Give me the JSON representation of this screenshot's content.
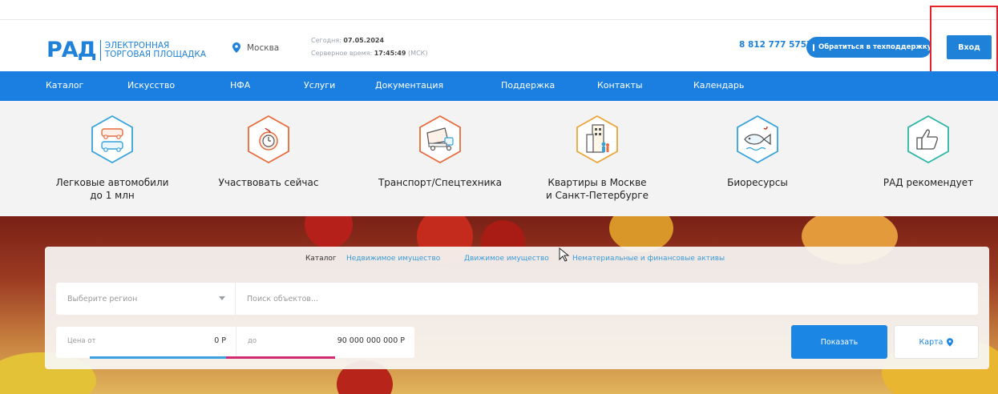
{
  "header": {
    "logo_mark": "РАД",
    "logo_line1": "ЭЛЕКТРОННАЯ",
    "logo_line2": "ТОРГОВАЯ ПЛОЩАДКА",
    "city": "Москва",
    "today_label": "Сегодня:",
    "today_value": "07.05.2024",
    "server_time_label": "Серверное время:",
    "server_time_value": "17:45:49",
    "server_time_zone": "(МСК)",
    "phone": "8 812 777 5757",
    "support_button": "Обратиться в техподдержку",
    "login_button": "Вход"
  },
  "nav": {
    "items": [
      "Каталог",
      "Искусство",
      "НФА",
      "Услуги",
      "Документация",
      "Поддержка",
      "Контакты",
      "Календарь"
    ]
  },
  "categories": [
    {
      "line1": "Легковые автомобили",
      "line2": "до 1 млн",
      "icon": "car-icon"
    },
    {
      "line1": "Участвовать сейчас",
      "line2": "",
      "icon": "timer-flame-icon"
    },
    {
      "line1": "Транспорт/Спецтехника",
      "line2": "",
      "icon": "dump-truck-icon"
    },
    {
      "line1": "Квартиры в Москве",
      "line2": "и Санкт-Петербурге",
      "icon": "apartment-building-icon"
    },
    {
      "line1": "Биоресурсы",
      "line2": "",
      "icon": "fish-icon"
    },
    {
      "line1": "РАД рекомендует",
      "line2": "",
      "icon": "thumbs-up-icon"
    }
  ],
  "search_panel": {
    "tabs": [
      "Каталог",
      "Недвижимое имущество",
      "Движимое имущество",
      "Нематериальные и финансовые активы"
    ],
    "active_tab": "Каталог",
    "region_placeholder": "Выберите регион",
    "search_placeholder": "Поиск объектов...",
    "price_from_label": "Цена от",
    "price_from_value": "0 Р",
    "price_to_label": "до",
    "price_to_value": "90 000 000 000 Р",
    "show_button": "Показать",
    "map_button": "Карта"
  },
  "colors": {
    "brand_blue": "#1b7fe1",
    "highlight_red": "#e8202a",
    "slider_blue": "#3aa2e0",
    "slider_pink": "#d02b72"
  }
}
